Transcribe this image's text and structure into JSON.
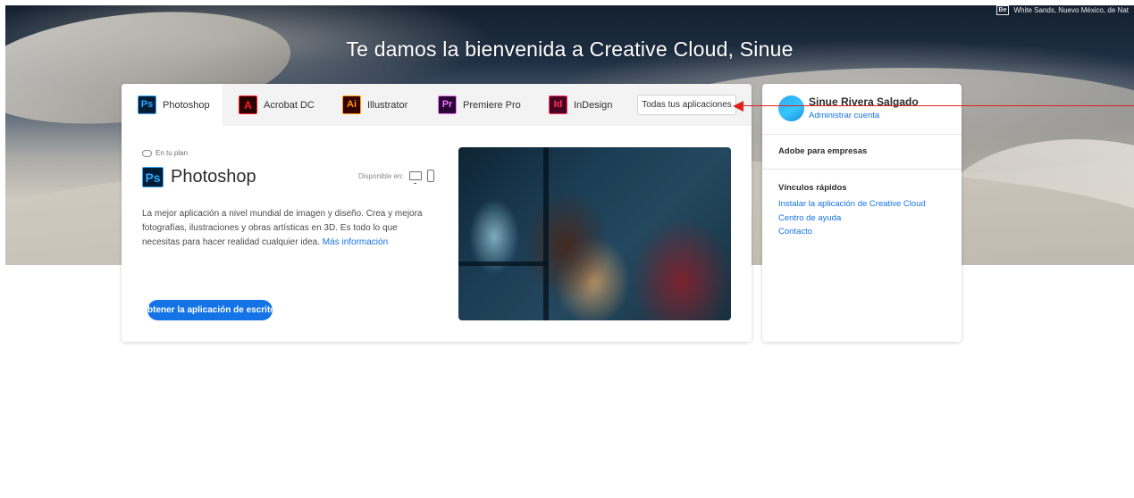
{
  "hero": {
    "title": "Te damos la bienvenida a Creative Cloud, Sinue",
    "photo_credit": "White Sands, Nuevo México, de Nat",
    "photo_credit_badge": "Be"
  },
  "tabs": [
    {
      "label": "Photoshop",
      "abbr": "Ps",
      "icon": "photoshop-icon",
      "active": true
    },
    {
      "label": "Acrobat DC",
      "abbr": "A",
      "icon": "acrobat-icon",
      "active": false
    },
    {
      "label": "Illustrator",
      "abbr": "Ai",
      "icon": "illustrator-icon",
      "active": false
    },
    {
      "label": "Premiere Pro",
      "abbr": "Pr",
      "icon": "premiere-icon",
      "active": false
    },
    {
      "label": "InDesign",
      "abbr": "Id",
      "icon": "indesign-icon",
      "active": false
    }
  ],
  "all_apps_button": "Todas tus aplicaciones",
  "product": {
    "plan_label": "En tu plan",
    "abbr": "Ps",
    "name": "Photoshop",
    "available_label": "Disponible en:",
    "description": "La mejor aplicación a nivel mundial de imagen y diseño. Crea y mejora fotografías, ilustraciones y obras artísticas en 3D. Es todo lo que necesitas para hacer realidad cualquier idea.",
    "more_link": "Más información",
    "cta_label": "btener la aplicación de escritorio"
  },
  "account": {
    "name": "Sinue Rivera Salgado",
    "manage_link": "Administrar cuenta",
    "business_label": "Adobe para empresas",
    "quick_links_heading": "Vínculos rápidos",
    "links": [
      "Instalar la aplicación de Creative Cloud",
      "Centro de ayuda",
      "Contacto"
    ]
  },
  "colors": {
    "accent": "#1473e6",
    "annotation": "#e0201a"
  }
}
